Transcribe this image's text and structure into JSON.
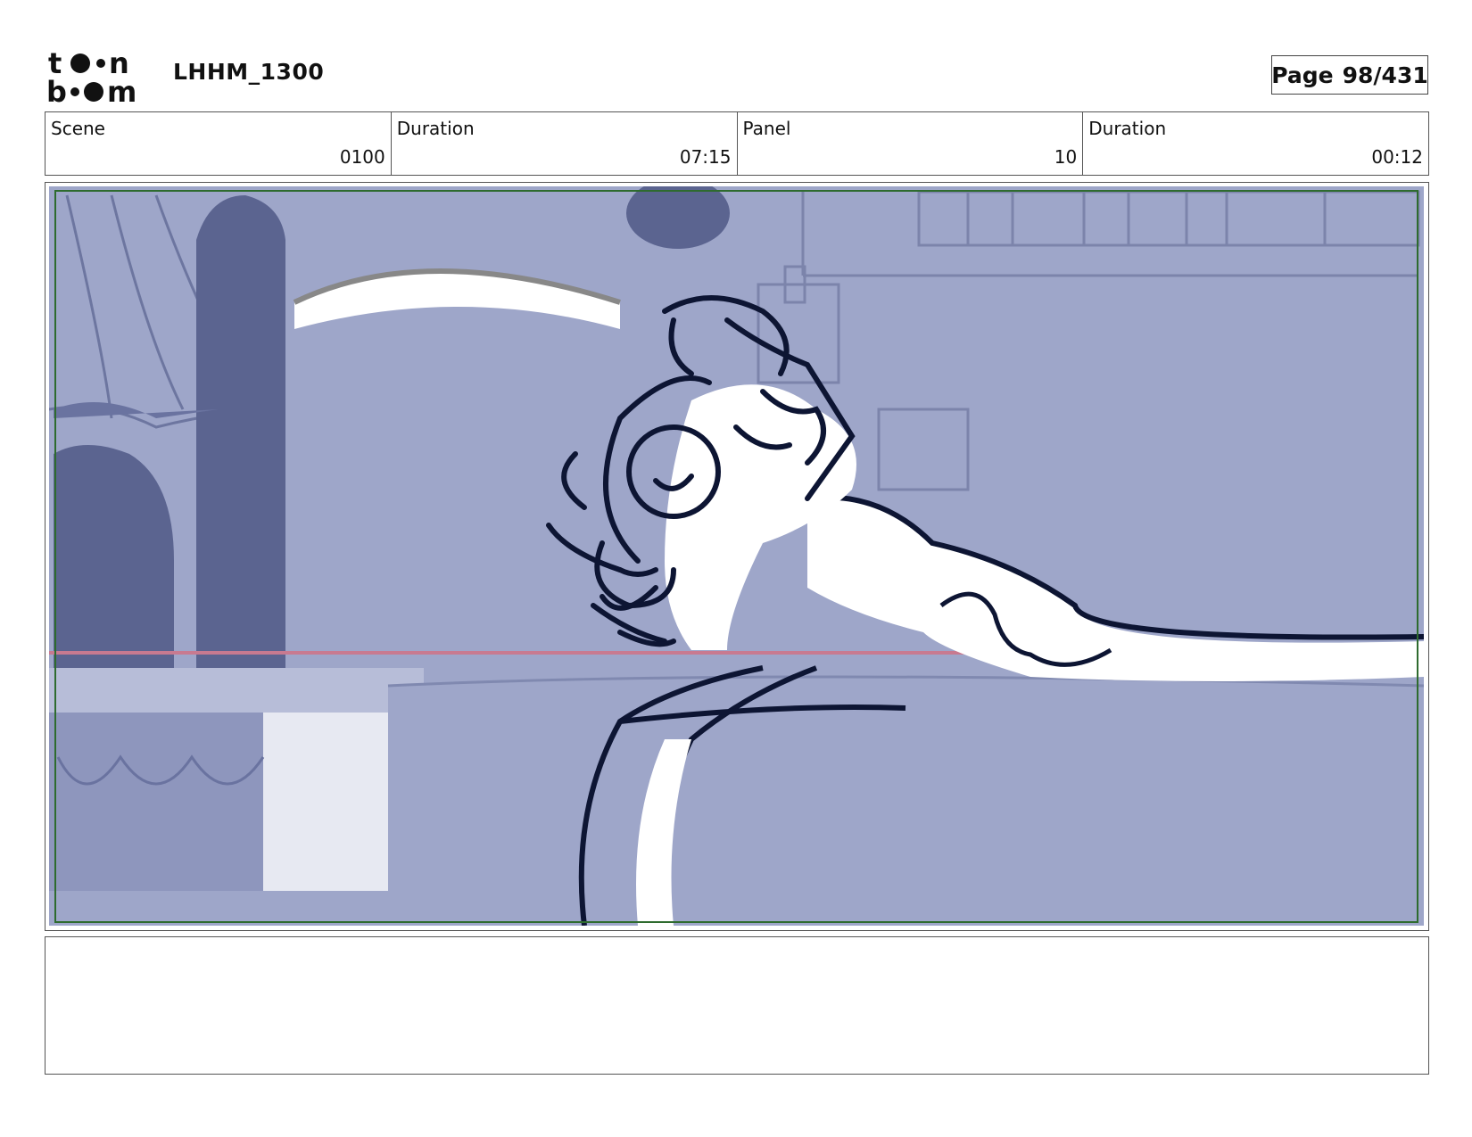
{
  "header": {
    "logo_text": "toon boom",
    "title": "LHHM_1300",
    "page_label": "Page",
    "page_value": "98/431"
  },
  "info": {
    "scene_label": "Scene",
    "scene_value": "0100",
    "scene_duration_label": "Duration",
    "scene_duration_value": "07:15",
    "panel_label": "Panel",
    "panel_value": "10",
    "panel_duration_label": "Duration",
    "panel_duration_value": "00:12"
  },
  "colors": {
    "background_tint": "#9ea6c9",
    "dark_shape": "#5b6490",
    "line_art": "#0d1533",
    "safe_frame": "#2e6b2e",
    "horizon_line": "#c87a90"
  },
  "notes": {
    "text": ""
  }
}
